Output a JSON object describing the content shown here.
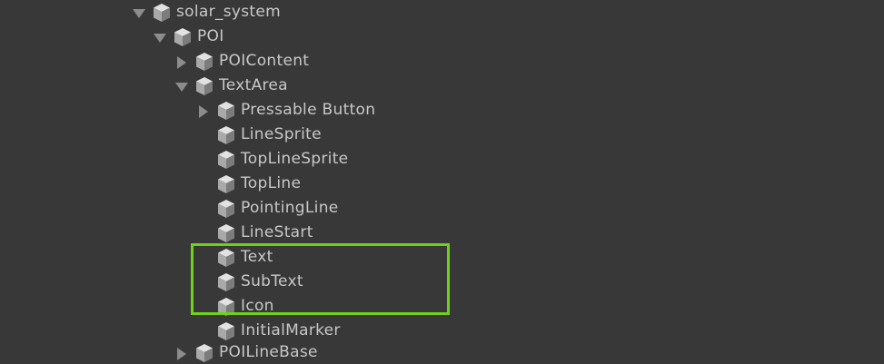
{
  "hierarchy": {
    "items": [
      {
        "label": "solar_system",
        "state": "expanded"
      },
      {
        "label": "POI",
        "state": "expanded"
      },
      {
        "label": "POIContent",
        "state": "collapsed"
      },
      {
        "label": "TextArea",
        "state": "expanded"
      },
      {
        "label": "Pressable Button",
        "state": "collapsed"
      },
      {
        "label": "LineSprite",
        "state": "leaf"
      },
      {
        "label": "TopLineSprite",
        "state": "leaf"
      },
      {
        "label": "TopLine",
        "state": "leaf"
      },
      {
        "label": "PointingLine",
        "state": "leaf"
      },
      {
        "label": "LineStart",
        "state": "leaf"
      },
      {
        "label": "Text",
        "state": "leaf"
      },
      {
        "label": "SubText",
        "state": "leaf"
      },
      {
        "label": "Icon",
        "state": "leaf"
      },
      {
        "label": "InitialMarker",
        "state": "leaf"
      },
      {
        "label": "POILineBase",
        "state": "collapsed"
      }
    ]
  },
  "colors": {
    "background": "#383838",
    "text": "#c8c8c8",
    "highlight": "#6fd218"
  }
}
